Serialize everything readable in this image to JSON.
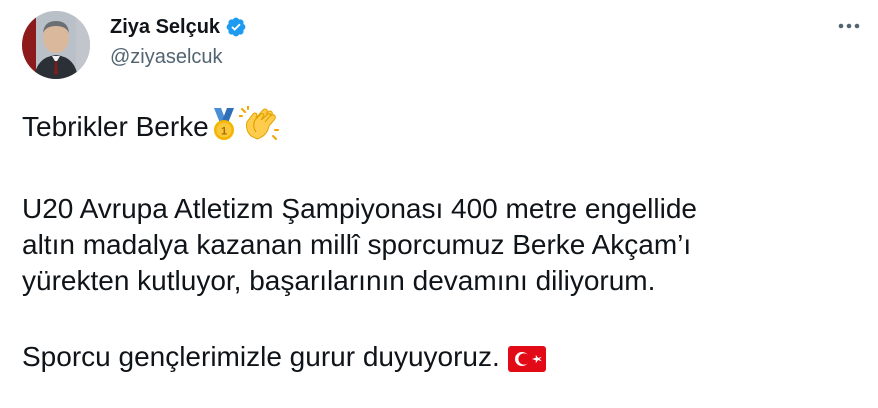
{
  "author": {
    "display_name": "Ziya Selçuk",
    "handle": "@ziyaselcuk",
    "verified": true
  },
  "icons": {
    "verified": "verified-badge-icon",
    "more": "more-options-icon",
    "medal": "first-place-medal-emoji",
    "clap": "clapping-hands-emoji",
    "flag": "turkey-flag-emoji"
  },
  "colors": {
    "verified_blue": "#1d9bf0",
    "text": "#0f1419",
    "handle": "#536471",
    "flag_red": "#e30a17"
  },
  "tweet": {
    "line1": "Tebrikler Berke",
    "line2": "U20 Avrupa Atletizm Şampiyonası 400 metre engellide",
    "line3": "altın madalya kazanan millî sporcumuz Berke Akçam’ı",
    "line4": "yürekten kutluyor, başarılarının devamını diliyorum.",
    "line5": "Sporcu gençlerimizle gurur duyuyoruz."
  }
}
